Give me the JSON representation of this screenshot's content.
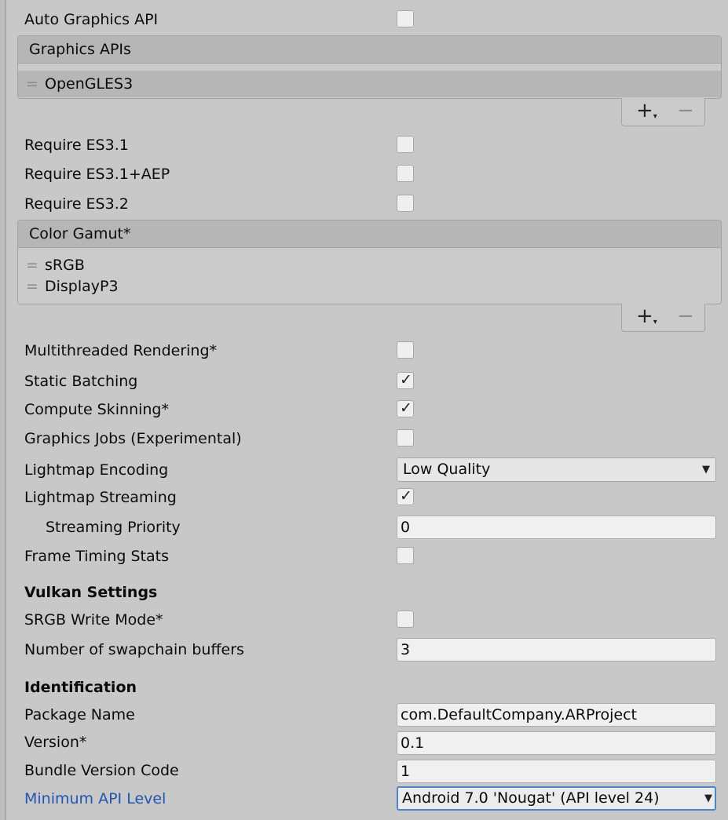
{
  "settings": {
    "auto_graphics_api": {
      "label": "Auto Graphics API",
      "checked": false
    },
    "graphics_apis": {
      "header": "Graphics APIs",
      "items": [
        "OpenGLES3"
      ]
    },
    "require_es31": {
      "label": "Require ES3.1",
      "checked": false
    },
    "require_es31_aep": {
      "label": "Require ES3.1+AEP",
      "checked": false
    },
    "require_es32": {
      "label": "Require ES3.2",
      "checked": false
    },
    "color_gamut": {
      "header": "Color Gamut*",
      "items": [
        "sRGB",
        "DisplayP3"
      ]
    },
    "multithreaded_rendering": {
      "label": "Multithreaded Rendering*",
      "checked": false
    },
    "static_batching": {
      "label": "Static Batching",
      "checked": true
    },
    "compute_skinning": {
      "label": "Compute Skinning*",
      "checked": true
    },
    "graphics_jobs": {
      "label": "Graphics Jobs (Experimental)",
      "checked": false
    },
    "lightmap_encoding": {
      "label": "Lightmap Encoding",
      "value": "Low Quality"
    },
    "lightmap_streaming": {
      "label": "Lightmap Streaming",
      "checked": true
    },
    "streaming_priority": {
      "label": "Streaming Priority",
      "value": "0"
    },
    "frame_timing_stats": {
      "label": "Frame Timing Stats",
      "checked": false
    }
  },
  "vulkan": {
    "heading": "Vulkan Settings",
    "srgb_write_mode": {
      "label": "SRGB Write Mode*",
      "checked": false
    },
    "swapchain_buffers": {
      "label": "Number of swapchain buffers",
      "value": "3"
    }
  },
  "identification": {
    "heading": "Identification",
    "package_name": {
      "label": "Package Name",
      "value": "com.DefaultCompany.ARProject"
    },
    "version": {
      "label": "Version*",
      "value": "0.1"
    },
    "bundle_version_code": {
      "label": "Bundle Version Code",
      "value": "1"
    },
    "minimum_api_level": {
      "label": "Minimum API Level",
      "value": "Android 7.0 'Nougat' (API level 24)"
    }
  },
  "glyphs": {
    "check": "✓",
    "drag": "=",
    "plus": "+",
    "plus_sub": "▾",
    "minus": "−",
    "dropdown_arrow": "▼"
  },
  "colors": {
    "link_label": "#2255b0",
    "focus_border": "#4a86c8",
    "panel_bg": "#c8c8c8"
  }
}
